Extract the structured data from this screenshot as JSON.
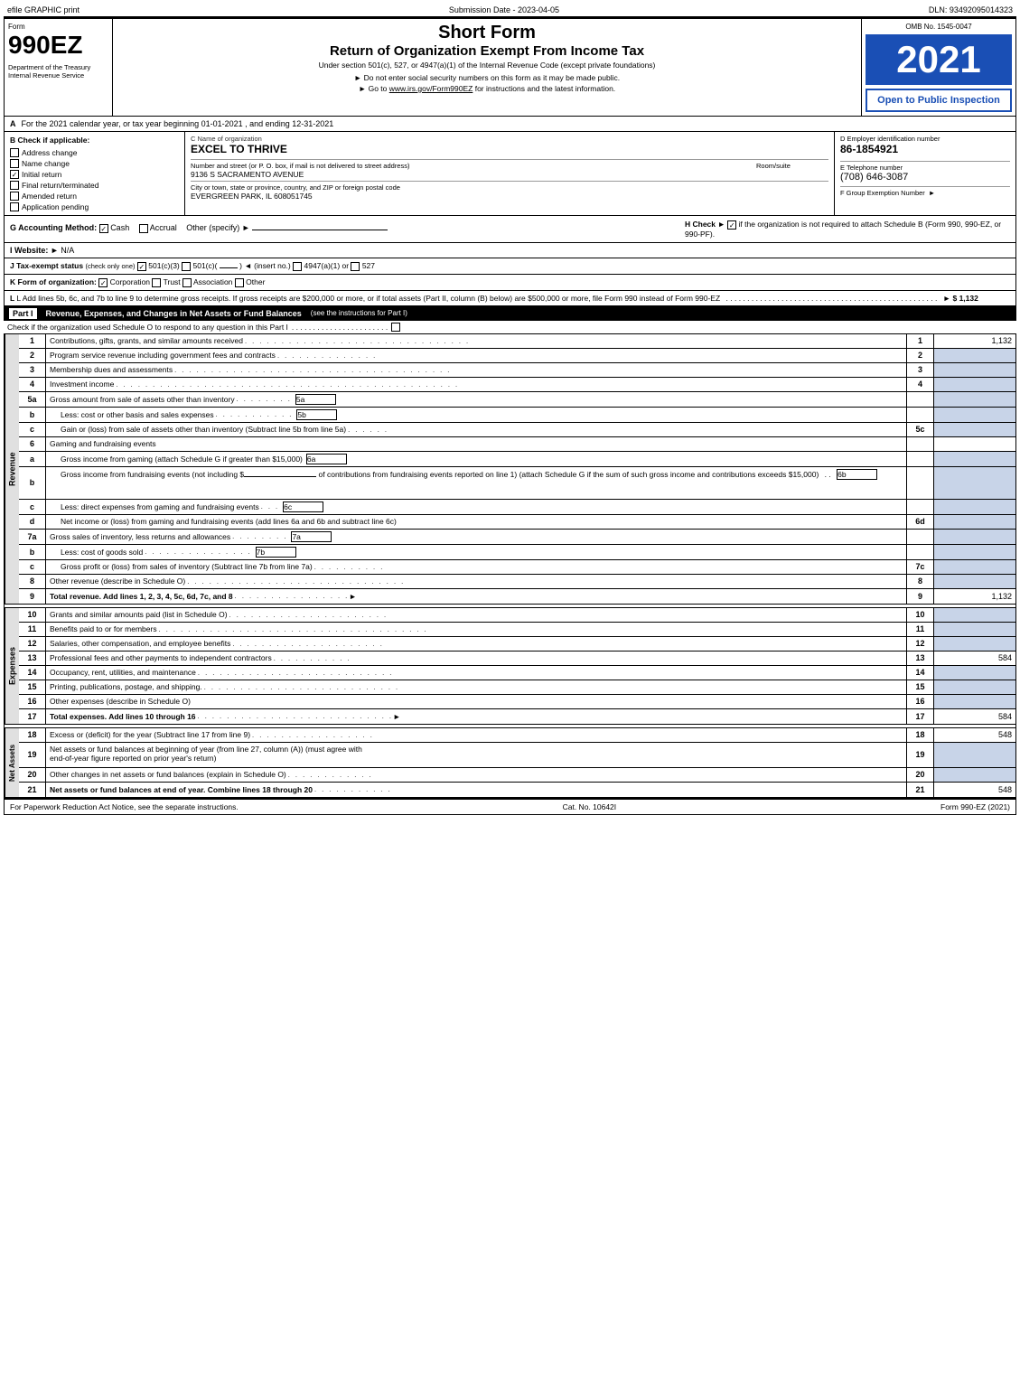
{
  "header": {
    "left": "efile GRAPHIC print",
    "center": "Submission Date - 2023-04-05",
    "right": "DLN: 93492095014323"
  },
  "form": {
    "number": "990EZ",
    "title1": "Short Form",
    "title2": "Return of Organization Exempt From Income Tax",
    "subtitle": "Under section 501(c), 527, or 4947(a)(1) of the Internal Revenue Code (except private foundations)",
    "note1": "► Do not enter social security numbers on this form as it may be made public.",
    "note2": "► Go to ",
    "link": "www.irs.gov/Form990EZ",
    "note2b": " for instructions and the latest information.",
    "omb": "OMB No. 1545-0047",
    "year": "2021",
    "open_label": "Open to Public Inspection",
    "dept": "Department of the Treasury Internal Revenue Service"
  },
  "section_a": {
    "label": "A",
    "text": "For the 2021 calendar year, or tax year beginning 01-01-2021 , and ending 12-31-2021"
  },
  "check_applicable": {
    "label": "B Check if applicable:",
    "options": [
      {
        "id": "address_change",
        "label": "Address change",
        "checked": false
      },
      {
        "id": "name_change",
        "label": "Name change",
        "checked": false
      },
      {
        "id": "initial_return",
        "label": "Initial return",
        "checked": true
      },
      {
        "id": "final_return",
        "label": "Final return/terminated",
        "checked": false
      },
      {
        "id": "amended_return",
        "label": "Amended return",
        "checked": false
      },
      {
        "id": "app_pending",
        "label": "Application pending",
        "checked": false
      }
    ]
  },
  "org": {
    "name_label": "C Name of organization",
    "name": "EXCEL TO THRIVE",
    "address_label": "Number and street (or P. O. box, if mail is not delivered to street address)",
    "address": "9136 S SACRAMENTO AVENUE",
    "room_label": "Room/suite",
    "room": "",
    "city_label": "City or town, state or province, country, and ZIP or foreign postal code",
    "city": "EVERGREEN PARK, IL  608051745"
  },
  "ein": {
    "label": "D Employer identification number",
    "number": "86-1854921",
    "phone_label": "E Telephone number",
    "phone": "(708) 646-3087",
    "group_label": "F Group Exemption Number",
    "group_num": ""
  },
  "accounting": {
    "label": "G Accounting Method:",
    "cash": "Cash",
    "accrual": "Accrual",
    "other": "Other (specify) ►",
    "cash_checked": true,
    "accrual_checked": false,
    "h_label": "H Check ►",
    "h_checked": true,
    "h_text": "if the organization is not required to attach Schedule B (Form 990, 990-EZ, or 990-PF)."
  },
  "website": {
    "label": "I Website: ►",
    "value": "N/A"
  },
  "tax_status": {
    "label": "J Tax-exempt status",
    "note": "(check only one)",
    "options": [
      "501(c)(3)",
      "501(c)(",
      "  ) ◄ (insert no.)",
      "4947(a)(1) or",
      "527"
    ],
    "checked": "501(c)(3)"
  },
  "k_form": {
    "label": "K Form of organization:",
    "options": [
      "Corporation",
      "Trust",
      "Association",
      "Other"
    ],
    "checked": "Corporation"
  },
  "l_text": "L Add lines 5b, 6c, and 7b to line 9 to determine gross receipts. If gross receipts are $200,000 or more, or if total assets (Part II, column (B) below) are $500,000 or more, file Form 990 instead of Form 990-EZ",
  "l_value": "► $ 1,132",
  "part1": {
    "label": "Part I",
    "title": "Revenue, Expenses, and Changes in Net Assets or Fund Balances",
    "note": "(see the instructions for Part I)",
    "check_row": "Check if the organization used Schedule O to respond to any question in this Part I",
    "rows": [
      {
        "num": "1",
        "desc": "Contributions, gifts, grants, and similar amounts received",
        "dots": true,
        "ref": "1",
        "val": "1,132",
        "bold": false
      },
      {
        "num": "2",
        "desc": "Program service revenue including government fees and contracts",
        "dots": true,
        "ref": "2",
        "val": "",
        "bold": false
      },
      {
        "num": "3",
        "desc": "Membership dues and assessments",
        "dots": true,
        "ref": "3",
        "val": "",
        "bold": false
      },
      {
        "num": "4",
        "desc": "Investment income",
        "dots": true,
        "ref": "4",
        "val": "",
        "bold": false
      },
      {
        "num": "5a",
        "desc": "Gross amount from sale of assets other than inventory",
        "dots": false,
        "ref": "5a",
        "inline_box": true,
        "val": "",
        "bold": false
      },
      {
        "num": "b",
        "desc": "Less: cost or other basis and sales expenses",
        "dots": false,
        "ref": "5b",
        "inline_box": true,
        "val": "",
        "bold": false,
        "indent": true
      },
      {
        "num": "c",
        "desc": "Gain or (loss) from sale of assets other than inventory (Subtract line 5b from line 5a)",
        "dots": true,
        "ref": "5c",
        "val": "",
        "bold": false,
        "indent": true
      },
      {
        "num": "6",
        "desc": "Gaming and fundraising events",
        "dots": false,
        "ref": "",
        "val": "",
        "bold": false
      },
      {
        "num": "a",
        "desc": "Gross income from gaming (attach Schedule G if greater than $15,000)",
        "dots": false,
        "ref": "6a",
        "inline_box": true,
        "val": "",
        "bold": false,
        "indent": true
      },
      {
        "num": "b",
        "desc": "Gross income from fundraising events (not including $                           of contributions from fundraising events reported on line 1) (attach Schedule G if the sum of such gross income and contributions exceeds $15,000)",
        "dots": false,
        "ref": "6b",
        "inline_box": true,
        "val": "",
        "bold": false,
        "indent": true,
        "multiline": true
      },
      {
        "num": "c",
        "desc": "Less: direct expenses from gaming and fundraising events",
        "dots": false,
        "ref": "6c",
        "inline_box": true,
        "val": "",
        "bold": false,
        "indent": true
      },
      {
        "num": "d",
        "desc": "Net income or (loss) from gaming and fundraising events (add lines 6a and 6b and subtract line 6c)",
        "dots": false,
        "ref": "6d",
        "val": "",
        "bold": false,
        "indent": true
      },
      {
        "num": "7a",
        "desc": "Gross sales of inventory, less returns and allowances",
        "dots": true,
        "ref": "7a",
        "inline_box": true,
        "val": "",
        "bold": false
      },
      {
        "num": "b",
        "desc": "Less: cost of goods sold",
        "dots": true,
        "ref": "7b",
        "inline_box": true,
        "val": "",
        "bold": false,
        "indent": true
      },
      {
        "num": "c",
        "desc": "Gross profit or (loss) from sales of inventory (Subtract line 7b from line 7a)",
        "dots": true,
        "ref": "7c",
        "val": "",
        "bold": false,
        "indent": true
      },
      {
        "num": "8",
        "desc": "Other revenue (describe in Schedule O)",
        "dots": true,
        "ref": "8",
        "val": "",
        "bold": false
      },
      {
        "num": "9",
        "desc": "Total revenue. Add lines 1, 2, 3, 4, 5c, 6d, 7c, and 8",
        "dots": true,
        "ref": "9",
        "val": "1,132",
        "bold": true,
        "arrow": true
      }
    ]
  },
  "expenses_rows": [
    {
      "num": "10",
      "desc": "Grants and similar amounts paid (list in Schedule O)",
      "dots": true,
      "ref": "10",
      "val": "",
      "bold": false
    },
    {
      "num": "11",
      "desc": "Benefits paid to or for members",
      "dots": true,
      "ref": "11",
      "val": "",
      "bold": false
    },
    {
      "num": "12",
      "desc": "Salaries, other compensation, and employee benefits",
      "dots": true,
      "ref": "12",
      "val": "",
      "bold": false
    },
    {
      "num": "13",
      "desc": "Professional fees and other payments to independent contractors",
      "dots": true,
      "ref": "13",
      "val": "584",
      "bold": false
    },
    {
      "num": "14",
      "desc": "Occupancy, rent, utilities, and maintenance",
      "dots": true,
      "ref": "14",
      "val": "",
      "bold": false
    },
    {
      "num": "15",
      "desc": "Printing, publications, postage, and shipping.",
      "dots": true,
      "ref": "15",
      "val": "",
      "bold": false
    },
    {
      "num": "16",
      "desc": "Other expenses (describe in Schedule O)",
      "dots": false,
      "ref": "16",
      "val": "",
      "bold": false
    },
    {
      "num": "17",
      "desc": "Total expenses. Add lines 10 through 16",
      "dots": true,
      "ref": "17",
      "val": "584",
      "bold": true,
      "arrow": true
    }
  ],
  "net_assets_rows": [
    {
      "num": "18",
      "desc": "Excess or (deficit) for the year (Subtract line 17 from line 9)",
      "dots": true,
      "ref": "18",
      "val": "548",
      "bold": false
    },
    {
      "num": "19",
      "desc": "Net assets or fund balances at beginning of year (from line 27, column (A)) (must agree with end-of-year figure reported on prior year's return)",
      "dots": false,
      "ref": "19",
      "val": "",
      "bold": false,
      "multiline": true
    },
    {
      "num": "20",
      "desc": "Other changes in net assets or fund balances (explain in Schedule O)",
      "dots": true,
      "ref": "20",
      "val": "",
      "bold": false
    },
    {
      "num": "21",
      "desc": "Net assets or fund balances at end of year. Combine lines 18 through 20",
      "dots": true,
      "ref": "21",
      "val": "548",
      "bold": true
    }
  ],
  "footer": {
    "left": "For Paperwork Reduction Act Notice, see the separate instructions.",
    "center": "Cat. No. 10642I",
    "right": "Form 990-EZ (2021)"
  }
}
